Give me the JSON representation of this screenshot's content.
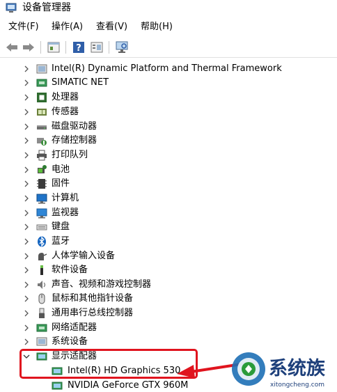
{
  "window": {
    "title": "设备管理器"
  },
  "menu": [
    {
      "label": "文件(F)"
    },
    {
      "label": "操作(A)"
    },
    {
      "label": "查看(V)"
    },
    {
      "label": "帮助(H)"
    }
  ],
  "toolbar": {
    "buttons": [
      {
        "icon": "back-arrow-icon"
      },
      {
        "icon": "forward-arrow-icon"
      },
      {
        "icon": "properties-icon"
      },
      {
        "icon": "help-icon"
      },
      {
        "icon": "update-driver-icon"
      },
      {
        "icon": "scan-hardware-icon"
      }
    ]
  },
  "tree": {
    "categories": [
      {
        "label": "Intel(R) Dynamic Platform and Thermal Framework",
        "icon": "thermal-framework-icon",
        "expanded": false
      },
      {
        "label": "SIMATIC NET",
        "icon": "network-icon",
        "expanded": false
      },
      {
        "label": "处理器",
        "icon": "processor-icon",
        "expanded": false
      },
      {
        "label": "传感器",
        "icon": "sensor-icon",
        "expanded": false
      },
      {
        "label": "磁盘驱动器",
        "icon": "disk-drive-icon",
        "expanded": false
      },
      {
        "label": "存储控制器",
        "icon": "storage-controller-icon",
        "expanded": false
      },
      {
        "label": "打印队列",
        "icon": "printer-icon",
        "expanded": false
      },
      {
        "label": "电池",
        "icon": "battery-icon",
        "expanded": false
      },
      {
        "label": "固件",
        "icon": "firmware-icon",
        "expanded": false
      },
      {
        "label": "计算机",
        "icon": "computer-icon",
        "expanded": false
      },
      {
        "label": "监视器",
        "icon": "monitor-icon",
        "expanded": false
      },
      {
        "label": "键盘",
        "icon": "keyboard-icon",
        "expanded": false
      },
      {
        "label": "蓝牙",
        "icon": "bluetooth-icon",
        "expanded": false
      },
      {
        "label": "人体学输入设备",
        "icon": "hid-icon",
        "expanded": false
      },
      {
        "label": "软件设备",
        "icon": "software-device-icon",
        "expanded": false
      },
      {
        "label": "声音、视频和游戏控制器",
        "icon": "sound-icon",
        "expanded": false
      },
      {
        "label": "鼠标和其他指针设备",
        "icon": "mouse-icon",
        "expanded": false
      },
      {
        "label": "通用串行总线控制器",
        "icon": "usb-icon",
        "expanded": false
      },
      {
        "label": "网络适配器",
        "icon": "network-adapter-icon",
        "expanded": false
      },
      {
        "label": "系统设备",
        "icon": "system-device-icon",
        "expanded": false
      },
      {
        "label": "显示适配器",
        "icon": "display-adapter-icon",
        "expanded": true,
        "children": [
          {
            "label": "Intel(R) HD Graphics 530",
            "icon": "display-adapter-icon"
          },
          {
            "label": "NVIDIA GeForce GTX 960M",
            "icon": "display-adapter-icon"
          }
        ]
      }
    ]
  },
  "annotation": {
    "color": "#e0141e"
  },
  "watermark": {
    "brand": "系统族",
    "url": "xitongcheng.com"
  }
}
